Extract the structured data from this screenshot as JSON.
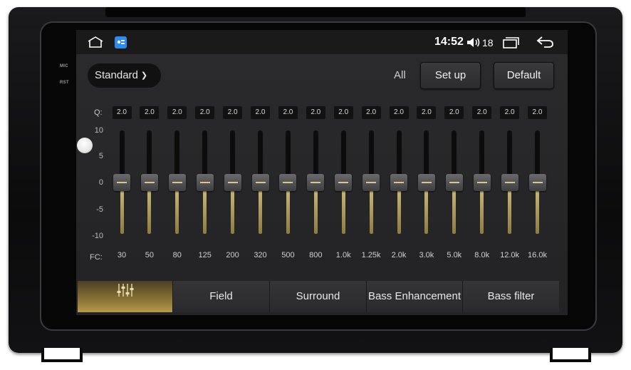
{
  "status_bar": {
    "time": "14:52",
    "volume": "18",
    "icons": [
      "home-icon",
      "app-badge-icon",
      "volume-icon",
      "recent-apps-icon",
      "back-icon"
    ]
  },
  "device": {
    "mic_label": "MIC",
    "rst_label": "RST"
  },
  "toolbar": {
    "preset": "Standard",
    "all_label": "All",
    "setup_label": "Set up",
    "default_label": "Default"
  },
  "eq": {
    "q_label": "Q:",
    "fc_label": "FC:",
    "scale": [
      "10",
      "5",
      "0",
      "-5",
      "-10"
    ],
    "q_values": [
      "2.0",
      "2.0",
      "2.0",
      "2.0",
      "2.0",
      "2.0",
      "2.0",
      "2.0",
      "2.0",
      "2.0",
      "2.0",
      "2.0",
      "2.0",
      "2.0",
      "2.0",
      "2.0"
    ],
    "gains": [
      0,
      0,
      0,
      0,
      0,
      0,
      0,
      0,
      0,
      0,
      0,
      0,
      0,
      0,
      0,
      0
    ],
    "frequencies": [
      "30",
      "50",
      "80",
      "125",
      "200",
      "320",
      "500",
      "800",
      "1.0k",
      "1.25k",
      "2.0k",
      "3.0k",
      "5.0k",
      "8.0k",
      "12.0k",
      "16.0k"
    ]
  },
  "tabs": [
    {
      "icon": "equalizer-icon",
      "label": ""
    },
    {
      "label": "Field"
    },
    {
      "label": "Surround"
    },
    {
      "label": "Bass Enhancement"
    },
    {
      "label": "Bass filter"
    }
  ],
  "colors": {
    "accent": "#c9b97a",
    "tab_active": "#8a7436"
  }
}
